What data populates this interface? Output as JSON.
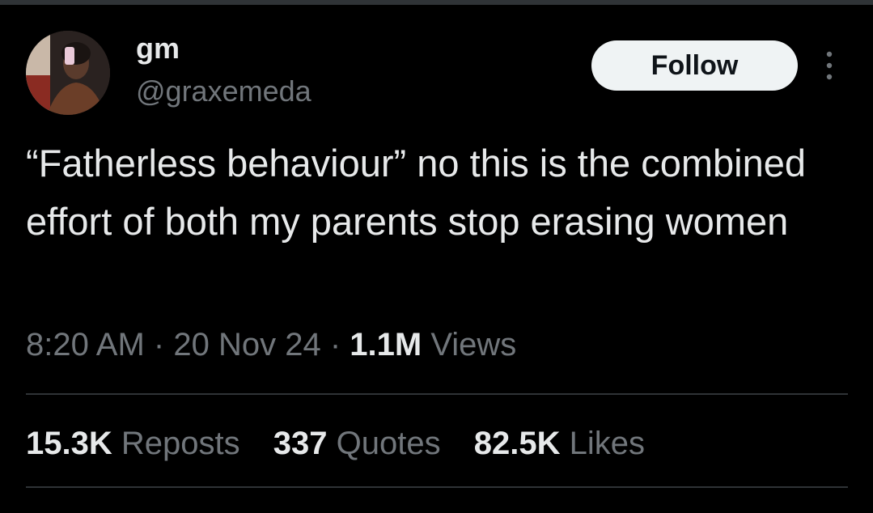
{
  "author": {
    "display_name": "gm",
    "handle": "@graxemeda"
  },
  "actions": {
    "follow_label": "Follow",
    "more_icon": "more-vertical-icon"
  },
  "tweet": {
    "text": "“Fatherless behaviour” no this is the combined effort of both my parents stop erasing women",
    "time": "8:20 AM",
    "date": "20 Nov 24",
    "separator": "·",
    "views_count": "1.1M",
    "views_label": "Views"
  },
  "stats": [
    {
      "count": "15.3K",
      "label": "Reposts"
    },
    {
      "count": "337",
      "label": "Quotes"
    },
    {
      "count": "82.5K",
      "label": "Likes"
    }
  ],
  "colors": {
    "background": "#000000",
    "primary_text": "#e7e9ea",
    "secondary_text": "#71767b",
    "divider": "#2f3336",
    "follow_button_bg": "#eff3f4",
    "follow_button_text": "#0f1419"
  }
}
